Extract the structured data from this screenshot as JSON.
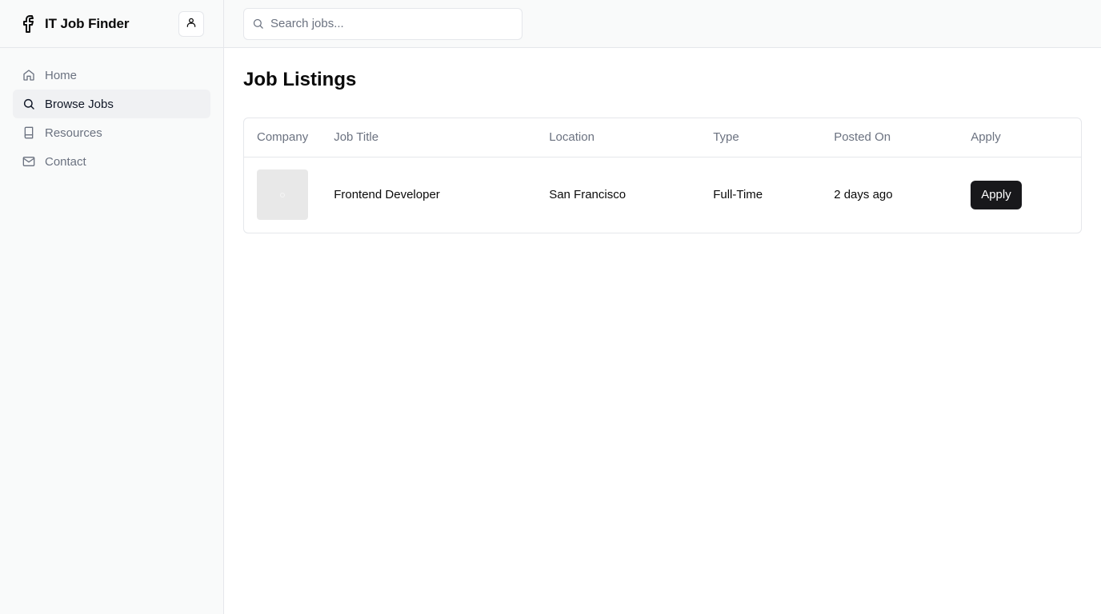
{
  "app": {
    "title": "IT Job Finder",
    "brand_icon": "facebook-icon",
    "user_icon": "user-icon"
  },
  "sidebar": {
    "items": [
      {
        "label": "Home",
        "icon": "home-icon",
        "active": false
      },
      {
        "label": "Browse Jobs",
        "icon": "search-icon",
        "active": true
      },
      {
        "label": "Resources",
        "icon": "book-icon",
        "active": false
      },
      {
        "label": "Contact",
        "icon": "mail-icon",
        "active": false
      }
    ]
  },
  "search": {
    "placeholder": "Search jobs...",
    "value": "",
    "icon": "search-icon"
  },
  "main": {
    "title": "Job Listings",
    "table": {
      "headers": [
        "Company",
        "Job Title",
        "Location",
        "Type",
        "Posted On",
        "Apply"
      ],
      "rows": [
        {
          "company_logo": "image-placeholder-icon",
          "job_title": "Frontend Developer",
          "location": "San Francisco",
          "type": "Full-Time",
          "posted_on": "2 days ago",
          "apply_label": "Apply"
        }
      ]
    }
  },
  "colors": {
    "accent": "#18181b",
    "sidebar_bg": "#f9fafa",
    "border": "#e5e7eb",
    "muted_text": "#6b7280",
    "active_bg": "#f0f1f3"
  }
}
